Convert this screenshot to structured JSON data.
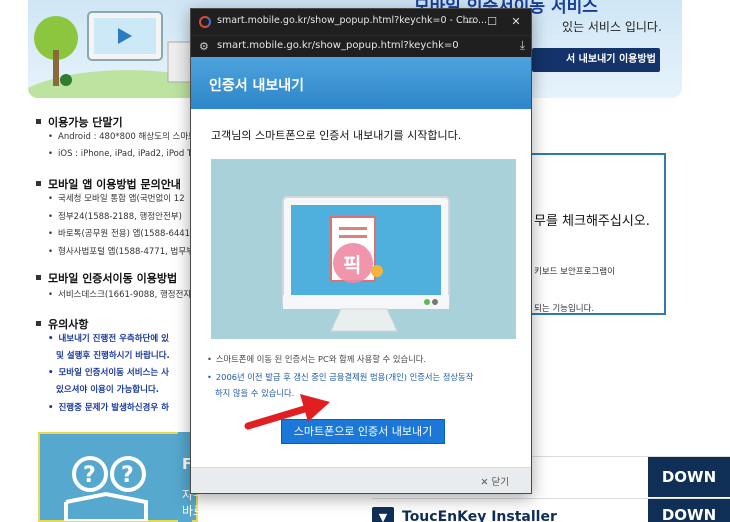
{
  "background": {
    "banner_title": "모바일 인증서이동 서비스",
    "banner_subtitle": "있는 서비스 입니다.",
    "guide_button": "서 내보내기 이용방법",
    "sections": [
      {
        "title": "이용가능 단말기",
        "lines": [
          "Android : 480*800 해상도의 스마트",
          "iOS : iPhone, iPad, iPad2, iPod T"
        ]
      },
      {
        "title": "모바일 앱 이용방법 문의안내",
        "lines": [
          "국세청 모바일 통합 앱(국번없이 12",
          "정부24(1588-2188, 행정안전부)",
          "바로톡(공무원 전용) 앱(1588-6441",
          "형사사법포털 앱(1588-4771, 법무부"
        ]
      },
      {
        "title": "모바일 인증서이동 이용방법",
        "lines": [
          "서비스데스크(1661-9088, 행정전자"
        ]
      },
      {
        "title": "유의사항",
        "lines": [
          "내보내기 진행전 우측하단에 있",
          "및 설행후 진행하시기 바랍니다.",
          "모바일 인증서이동 서비스는 사",
          "있으셔야 이용이 가능합니다.",
          "진행중 문제가 발생하신경우 하"
        ]
      }
    ],
    "right_box": {
      "line1": "무를 체크해주십시오.",
      "line2": "키보드 보안프로그램이",
      "line3": "되는 기능입니다."
    },
    "faq": {
      "label": "FA",
      "line1": "자수 묻는 질문사항",
      "line2": "바로 확인하기"
    },
    "downloads": [
      {
        "name": "",
        "button": "DOWN"
      },
      {
        "name": "ToucEnKey Installer",
        "button": "DOWN"
      }
    ]
  },
  "popup": {
    "window_title": "smart.mobile.go.kr/show_popup.html?keychk=0 - Chro...",
    "url": "smart.mobile.go.kr/show_popup.html?keychk=0",
    "header_title": "인증서 내보내기",
    "intro": "고객님의 스마트폰으로 인증서 내보내기를 시작합니다.",
    "notes": [
      "스마트폰에 이동 된 인증서는 PC와 함께 사용할 수 있습니다.",
      "2006년 이전 발급 후 갱신 중인 금융결제원 범용(개인) 인증서는 정상동작",
      "하지 않을 수 있습니다."
    ],
    "export_button": "스마트폰으로 인증서 내보내기",
    "close_label": "닫기",
    "illustration_stamp": "픽"
  },
  "colors": {
    "popup_header": "#2d86c9",
    "export_button": "#1b78d8",
    "arrow": "#e02020",
    "download_button": "#0f2f57"
  }
}
